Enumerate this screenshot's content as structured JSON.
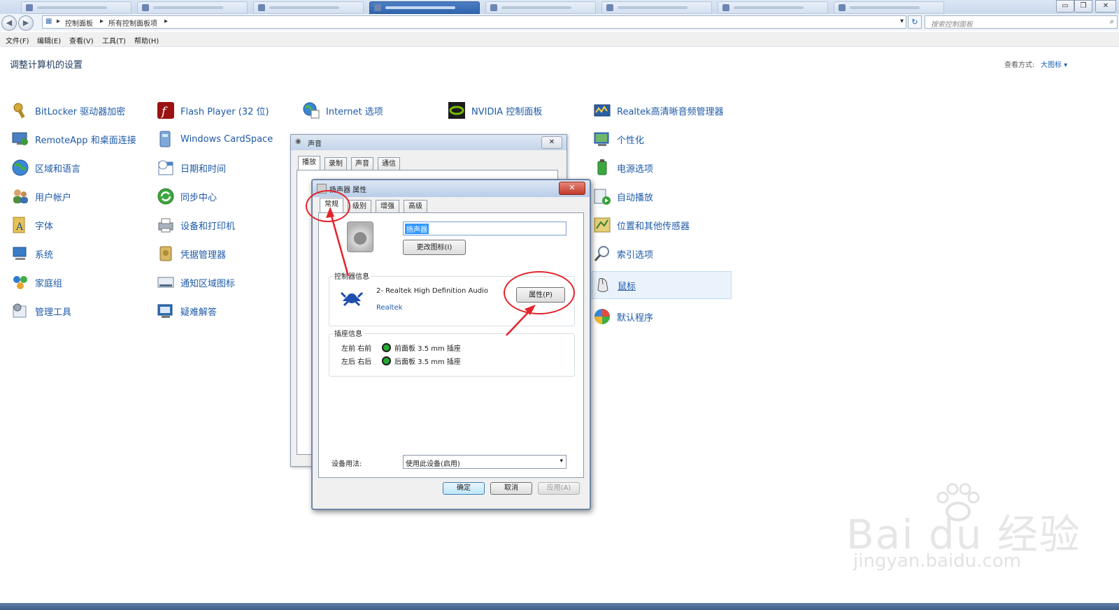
{
  "breadcrumb": [
    "控制面板",
    "所有控制面板项"
  ],
  "search": {
    "placeholder": "搜索控制面板"
  },
  "menu": [
    "文件(F)",
    "编辑(E)",
    "查看(V)",
    "工具(T)",
    "帮助(H)"
  ],
  "header": {
    "title": "调整计算机的设置",
    "view_by_label": "查看方式:",
    "view_by_value": "大图标 ▾"
  },
  "columns": [
    {
      "items": [
        {
          "label": "BitLocker 驱动器加密",
          "icon": "key-icon"
        },
        {
          "label": "RemoteApp 和桌面连接",
          "icon": "remote-desktop-icon"
        },
        {
          "label": "区域和语言",
          "icon": "globe-icon"
        },
        {
          "label": "用户帐户",
          "icon": "users-icon"
        },
        {
          "label": "字体",
          "icon": "font-icon"
        },
        {
          "label": "系统",
          "icon": "computer-icon"
        },
        {
          "label": "家庭组",
          "icon": "homegroup-icon"
        },
        {
          "label": "管理工具",
          "icon": "admin-tools-icon"
        }
      ]
    },
    {
      "items": [
        {
          "label": "Flash Player (32 位)",
          "icon": "flash-icon"
        },
        {
          "label": "Windows CardSpace",
          "icon": "cardspace-icon"
        },
        {
          "label": "日期和时间",
          "icon": "calendar-icon"
        },
        {
          "label": "同步中心",
          "icon": "sync-icon"
        },
        {
          "label": "设备和打印机",
          "icon": "printer-icon"
        },
        {
          "label": "凭据管理器",
          "icon": "credential-icon"
        },
        {
          "label": "通知区域图标",
          "icon": "notification-icon"
        },
        {
          "label": "疑难解答",
          "icon": "troubleshoot-icon"
        }
      ]
    },
    {
      "items": [
        {
          "label": "Internet 选项",
          "icon": "internet-icon"
        }
      ]
    },
    {
      "items": [
        {
          "label": "NVIDIA 控制面板",
          "icon": "nvidia-icon"
        }
      ]
    },
    {
      "items": [
        {
          "label": "Realtek高清晰音频管理器",
          "icon": "audio-manager-icon"
        },
        {
          "label": "个性化",
          "icon": "personalize-icon"
        },
        {
          "label": "电源选项",
          "icon": "power-icon"
        },
        {
          "label": "自动播放",
          "icon": "autoplay-icon"
        },
        {
          "label": "位置和其他传感器",
          "icon": "sensor-icon"
        },
        {
          "label": "索引选项",
          "icon": "index-icon"
        },
        {
          "label": "鼠标",
          "icon": "mouse-icon",
          "highlighted": true
        },
        {
          "label": "默认程序",
          "icon": "default-programs-icon"
        }
      ]
    }
  ],
  "sound_dialog": {
    "title": "声音",
    "tabs": [
      "播放",
      "录制",
      "声音",
      "通信"
    ]
  },
  "speaker_dialog": {
    "title": "扬声器 属性",
    "tabs": [
      "常规",
      "级别",
      "增强",
      "高级"
    ],
    "name_value": "扬声器",
    "change_icon_button": "更改图标(I)",
    "controller_group": "控制器信息",
    "controller_name": "2- Realtek High Definition Audio",
    "controller_vendor": "Realtek",
    "properties_button": "属性(P)",
    "jack_group": "插座信息",
    "jacks": [
      {
        "channels": "左前 右前",
        "desc": "前面板 3.5 mm 插座"
      },
      {
        "channels": "左后 右后",
        "desc": "后面板 3.5 mm 插座"
      }
    ],
    "usage_label": "设备用法:",
    "usage_value": "使用此设备(启用)",
    "ok": "确定",
    "cancel": "取消",
    "apply": "应用(A)"
  },
  "watermark": {
    "main": "Bai du 经验",
    "url": "jingyan.baidu.com"
  },
  "colors": {
    "link": "#1e5aa8",
    "annotation": "#e3242b",
    "selected_text": "#3399ff"
  }
}
